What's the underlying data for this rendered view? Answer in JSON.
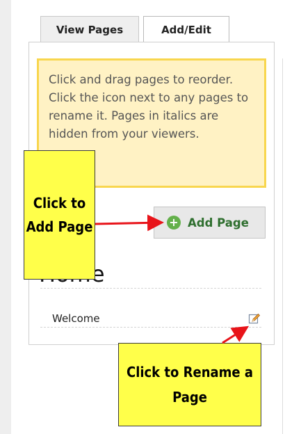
{
  "tabs": {
    "view_pages": "View Pages",
    "add_edit": "Add/Edit"
  },
  "notice": {
    "text": "Click and drag pages to reorder. Click the icon next to any pages to rename it. Pages in italics are hidden from your viewers."
  },
  "add_page_button": {
    "label": "Add Page",
    "icon": "plus-circle-icon"
  },
  "section": {
    "title": "Home"
  },
  "pages": [
    {
      "label": "Welcome",
      "icon": "pencil-edit-icon"
    }
  ],
  "annotations": {
    "add_page": "Click to Add Page",
    "rename_page": "Click to Rename a Page"
  },
  "colors": {
    "notice_bg": "#fff2c4",
    "notice_border": "#f8d64e",
    "callout_bg": "#ffff4a",
    "arrow": "#e8141a",
    "plus_icon": "#63b04a"
  }
}
